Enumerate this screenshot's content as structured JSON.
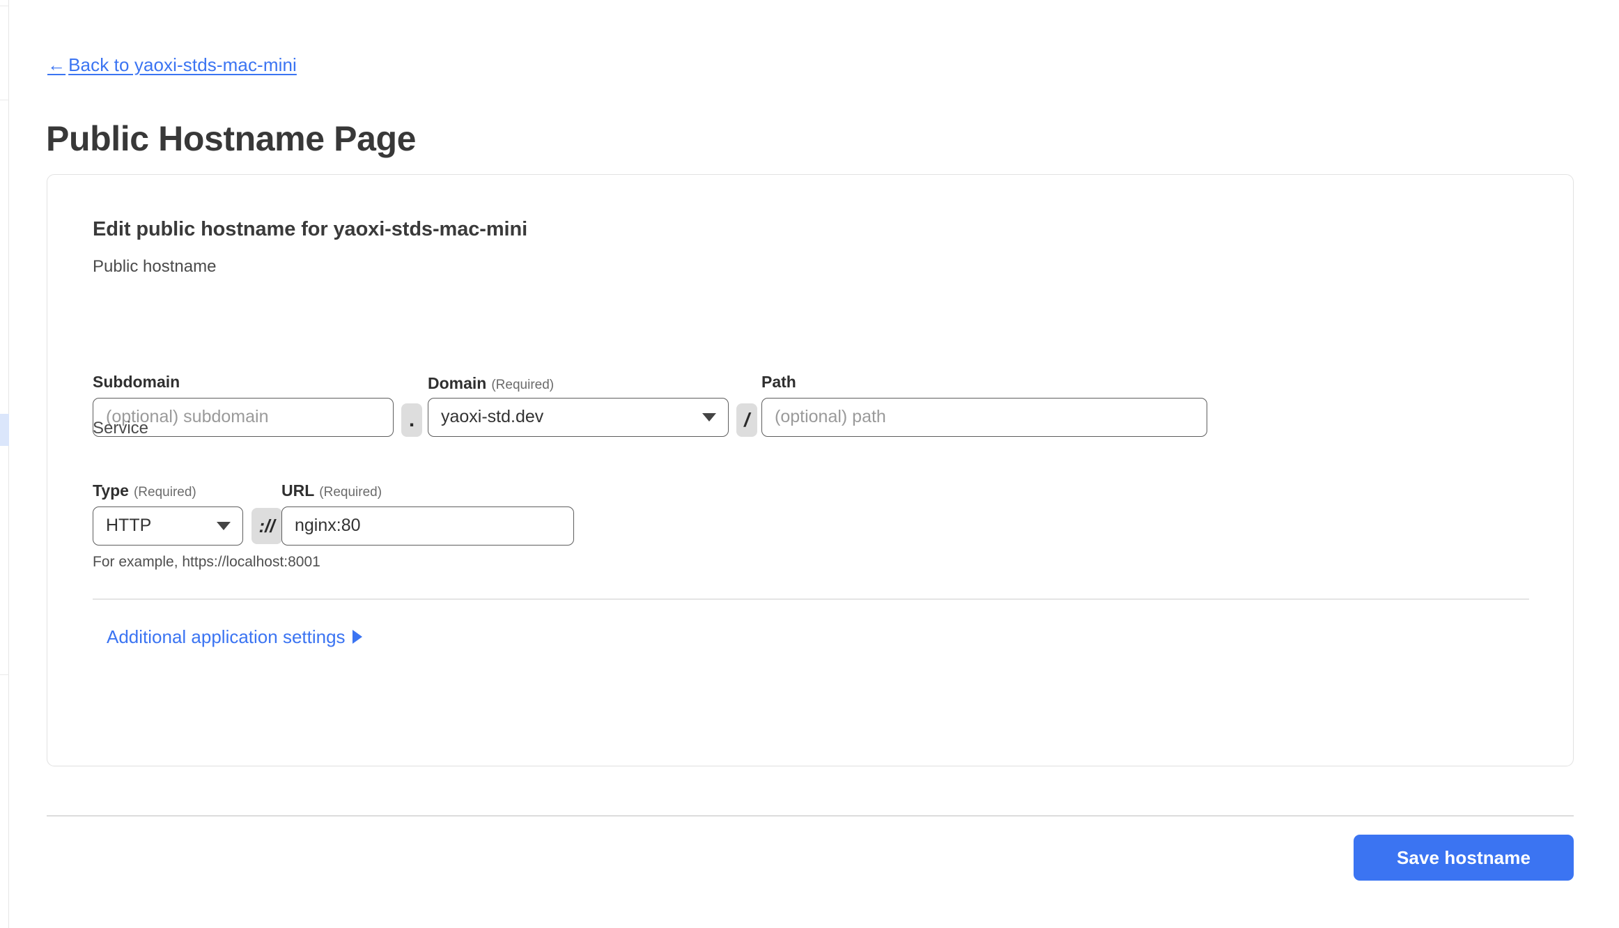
{
  "back_link": {
    "arrow": "←",
    "label": "Back to yaoxi-stds-mac-mini"
  },
  "page_title": "Public Hostname Page",
  "card": {
    "title": "Edit public hostname for yaoxi-stds-mac-mini",
    "public_hostname_section_label": "Public hostname",
    "service_section_label": "Service",
    "fields": {
      "subdomain": {
        "label": "Subdomain",
        "required_note": "",
        "value": "",
        "placeholder": "(optional) subdomain"
      },
      "domain": {
        "label": "Domain",
        "required_note": "(Required)",
        "value": "yaoxi-std.dev",
        "options": [
          "yaoxi-std.dev"
        ]
      },
      "path": {
        "label": "Path",
        "required_note": "",
        "value": "",
        "placeholder": "(optional) path"
      },
      "type": {
        "label": "Type",
        "required_note": "(Required)",
        "value": "HTTP",
        "options": [
          "HTTP"
        ]
      },
      "url": {
        "label": "URL",
        "required_note": "(Required)",
        "value": "nginx:80",
        "placeholder": ""
      }
    },
    "separators": {
      "dot": ".",
      "slash": "/",
      "protocol": "://"
    },
    "helper_text": "For example, https://localhost:8001",
    "additional_settings_label": "Additional application settings"
  },
  "footer": {
    "save_label": "Save hostname"
  },
  "colors": {
    "accent_blue": "#3b74f2",
    "link_blue": "#3b74f2",
    "input_border": "#5d5d5d",
    "card_border": "#e2e2e2",
    "separator_bg": "#dddddd"
  }
}
